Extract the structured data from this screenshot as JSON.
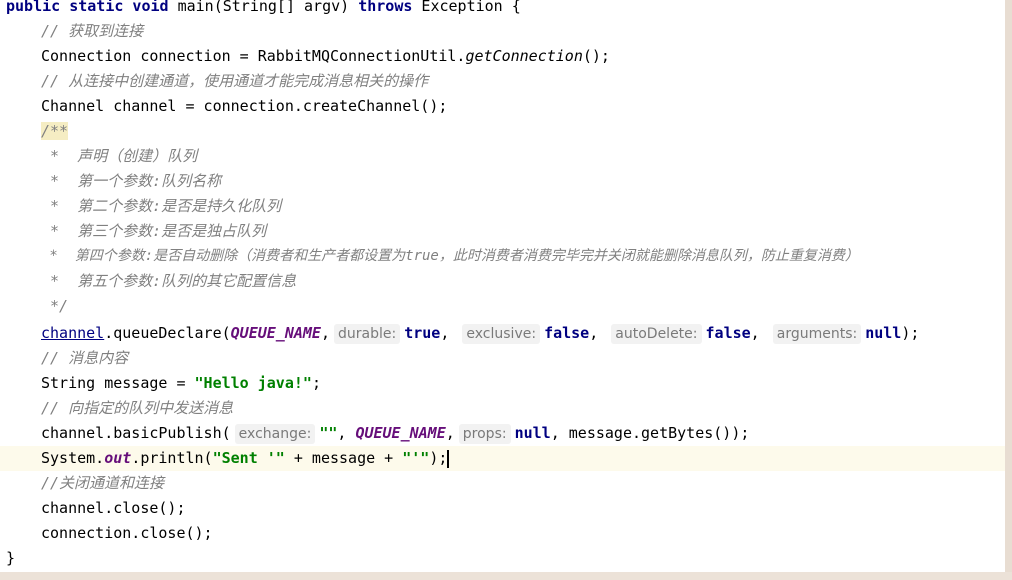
{
  "lines": {
    "l01": {
      "kw1": "public static void",
      "t1": " main(String[] argv) ",
      "kw2": "throws",
      "t2": " Exception {"
    },
    "l02": {
      "c": "// 获取到连接"
    },
    "l03": {
      "t1": "Connection connection = RabbitMQConnectionUtil.",
      "m": "getConnection",
      "t2": "();"
    },
    "l04": {
      "c": "// 从连接中创建通道，使用通道才能完成消息相关的操作"
    },
    "l05": {
      "t": "Channel channel = connection.createChannel();"
    },
    "l06": {
      "c": "/**"
    },
    "l07": {
      "c": " *  声明（创建）队列"
    },
    "l08": {
      "c": " *  第一个参数:队列名称"
    },
    "l09": {
      "c": " *  第二个参数:是否是持久化队列"
    },
    "l10": {
      "c": " *  第三个参数:是否是独占队列"
    },
    "l11": {
      "c": " *  第四个参数:是否自动删除（消费者和生产者都设置为true，此时消费者消费完毕完并关闭就能删除消息队列，防止重复消费）"
    },
    "l12": {
      "c": " *  第五个参数:队列的其它配置信息"
    },
    "l13": {
      "c": " */"
    },
    "l14": {
      "obj": "channel",
      "t1": ".queueDeclare(",
      "const": "QUEUE_NAME",
      "sep": ",",
      "h1": "durable:",
      "v1": "true",
      "h2": "exclusive:",
      "v2": "false",
      "h3": "autoDelete:",
      "v3": "false",
      "h4": "arguments:",
      "v4": "null",
      "t2": ");"
    },
    "l15": {
      "c": "// 消息内容"
    },
    "l16": {
      "t1": "String message = ",
      "s": "\"Hello java!\"",
      "t2": ";"
    },
    "l17": {
      "c": "// 向指定的队列中发送消息"
    },
    "l18": {
      "t1": "channel.basicPublish(",
      "h1": "exchange:",
      "s": "\"\"",
      "sep1": ",",
      "const": "QUEUE_NAME",
      "sep2": ",",
      "h2": "props:",
      "v": "null",
      "t2": ", message.getBytes());"
    },
    "l19": {
      "t1": "System.",
      "f": "out",
      "t2": ".println(",
      "s1": "\"Sent '\"",
      "t3": " + message + ",
      "s2": "\"'\"",
      "t4": ");"
    },
    "l20": {
      "c": "//关闭通道和连接"
    },
    "l21": {
      "t": "channel.close();"
    },
    "l22": {
      "t": "connection.close();"
    },
    "l23": {
      "t": "}"
    }
  }
}
